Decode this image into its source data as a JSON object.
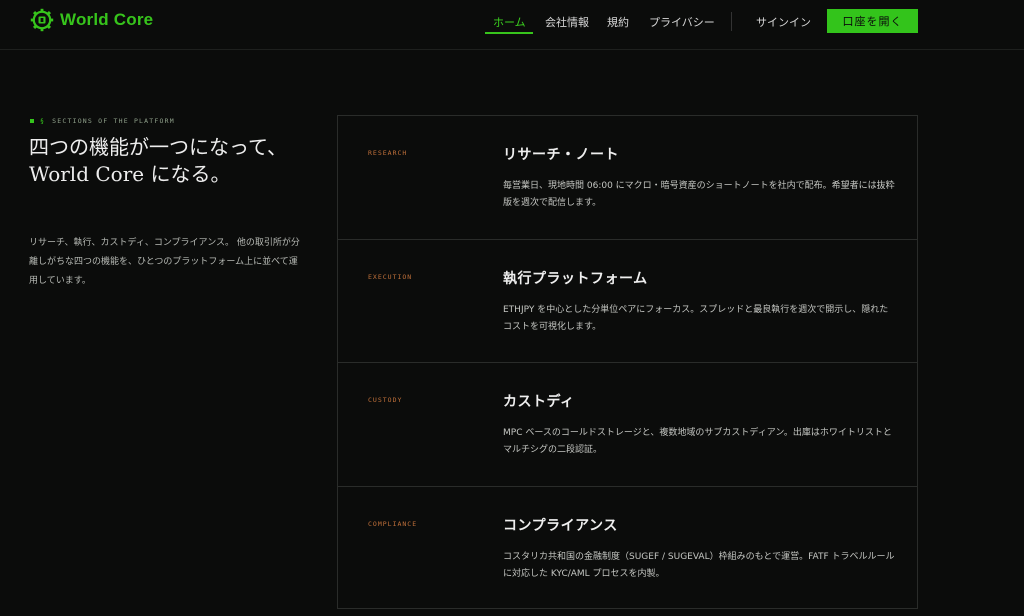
{
  "brand": {
    "name": "World Core",
    "accent": "#37c41c"
  },
  "nav": {
    "items": [
      {
        "label": "ホーム",
        "active": true
      },
      {
        "label": "会社情報",
        "active": false
      },
      {
        "label": "規約",
        "active": false
      },
      {
        "label": "プライバシー",
        "active": false
      }
    ],
    "signin": "サインイン",
    "cta": "口座を開く"
  },
  "intro": {
    "eyebrow_number": "§",
    "eyebrow_text": "SECTIONS OF THE PLATFORM",
    "headline": "四つの機能が一つになって、\nWorld Core になる。",
    "lead": "リサーチ、執行、カストディ、コンプライアンス。 他の取引所が分離しがちな四つの機能を、ひとつのプラットフォーム上に並べて運用しています。"
  },
  "cards": [
    {
      "tag": "RESEARCH",
      "title": "リサーチ・ノート",
      "body": "毎営業日、現地時間 06:00 にマクロ・暗号資産のショートノートを社内で配布。希望者には抜粋版を週次で配信します。"
    },
    {
      "tag": "EXECUTION",
      "title": "執行プラットフォーム",
      "body": "ETHJPY を中心とした分単位ペアにフォーカス。スプレッドと最良執行を週次で開示し、隠れたコストを可視化します。"
    },
    {
      "tag": "CUSTODY",
      "title": "カストディ",
      "body": "MPC ベースのコールドストレージと、複数地域のサブカストディアン。出庫はホワイトリストとマルチシグの二段認証。"
    },
    {
      "tag": "COMPLIANCE",
      "title": "コンプライアンス",
      "body": "コスタリカ共和国の金融制度（SUGEF / SUGEVAL）枠組みのもとで運営。FATF トラベルルールに対応した KYC/AML プロセスを内製。"
    }
  ]
}
